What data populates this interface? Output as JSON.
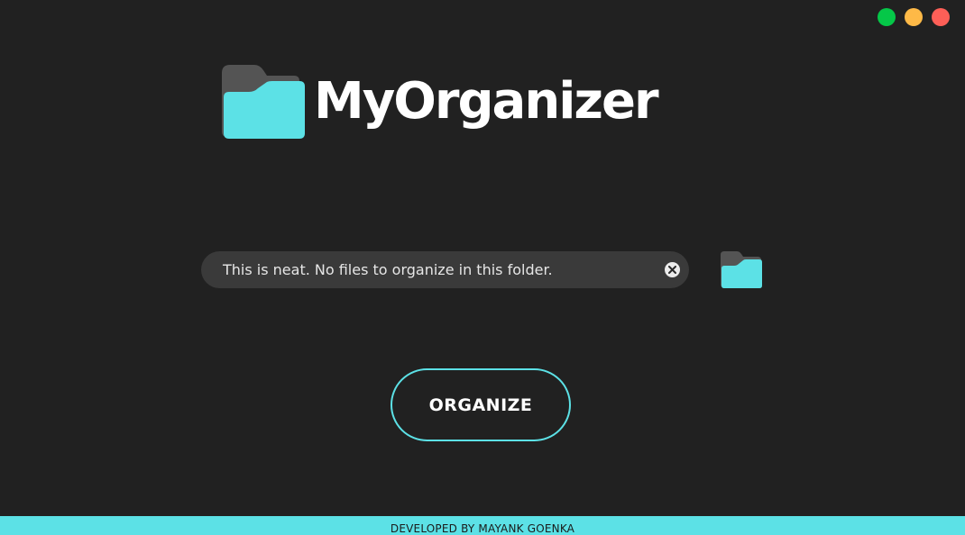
{
  "app": {
    "title": "MyOrganizer"
  },
  "window_controls": {
    "maximize": {
      "icon": "maximize-icon",
      "color": "#05c748"
    },
    "minimize": {
      "icon": "minimize-icon",
      "color": "#feb947"
    },
    "close": {
      "icon": "close-icon",
      "color": "#fe5f57"
    }
  },
  "logo": {
    "icon": "folder-icon",
    "back_color": "#545454",
    "front_color": "#5ce1e6"
  },
  "folder_field": {
    "value": "This is neat. No files to organize in this folder.",
    "clear_icon": "clear-icon"
  },
  "browse": {
    "icon": "folder-icon"
  },
  "organize_button": {
    "label": "ORGANIZE"
  },
  "footer": {
    "text": "DEVELOPED BY MAYANK GOENKA",
    "color": "#5ce1e6"
  },
  "colors": {
    "background": "#212121",
    "accent": "#5ce1e6",
    "field_background": "#3a3a3a"
  }
}
